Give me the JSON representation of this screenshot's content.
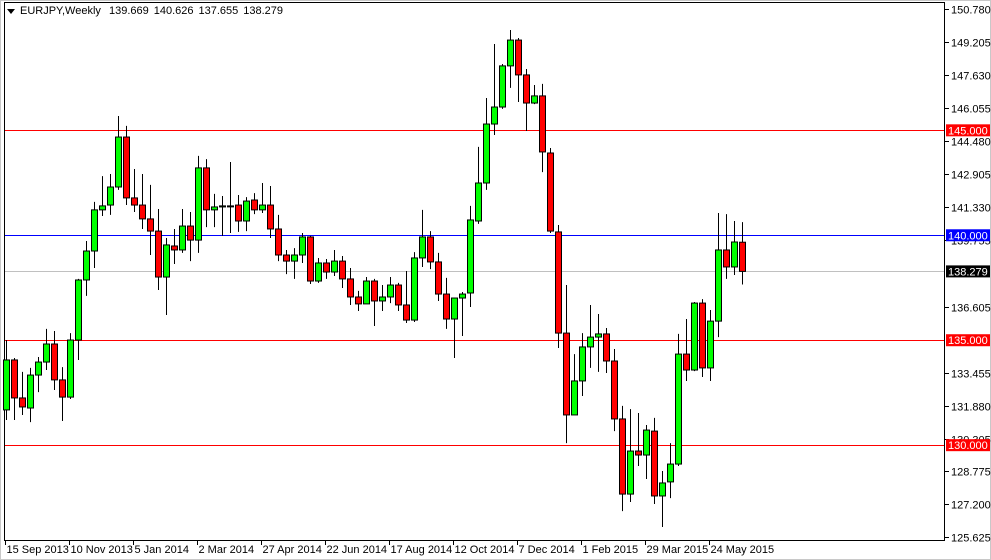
{
  "header": {
    "symbol_timeframe": "EURJPY,Weekly",
    "open": "139.669",
    "high": "140.626",
    "low": "137.655",
    "close": "138.279"
  },
  "colors": {
    "bull": "#00ff00",
    "bear": "#ff0000",
    "level_red": "#ff0000",
    "level_blue": "#0000ff",
    "current": "#c0c0c0"
  },
  "chart_data": {
    "type": "candlestick",
    "title": "EURJPY,Weekly",
    "ylim": [
      125.625,
      150.78
    ],
    "y_ticks": [
      "150.780",
      "149.205",
      "147.630",
      "146.055",
      "144.480",
      "142.905",
      "141.330",
      "139.755",
      "136.605",
      "133.455",
      "131.880",
      "130.305",
      "128.775",
      "127.200",
      "125.625"
    ],
    "x_labels": [
      "15 Sep 2013",
      "10 Nov 2013",
      "5 Jan 2014",
      "2 Mar 2014",
      "27 Apr 2014",
      "22 Jun 2014",
      "17 Aug 2014",
      "12 Oct 2014",
      "7 Dec 2014",
      "1 Feb 2015",
      "29 Mar 2015",
      "24 May 2015"
    ],
    "x_label_every": 8,
    "levels": [
      {
        "price": 145.0,
        "label": "145.000",
        "color": "red"
      },
      {
        "price": 140.0,
        "label": "140.000",
        "color": "blue"
      },
      {
        "price": 135.0,
        "label": "135.000",
        "color": "red"
      },
      {
        "price": 130.0,
        "label": "130.000",
        "color": "red"
      }
    ],
    "current_price": {
      "price": 138.279,
      "label": "138.279"
    },
    "ohlc": [
      [
        131.68,
        135.01,
        131.2,
        134.06
      ],
      [
        134.06,
        134.15,
        131.2,
        132.25
      ],
      [
        132.25,
        133.49,
        131.44,
        131.82
      ],
      [
        131.77,
        133.68,
        131.1,
        133.34
      ],
      [
        133.34,
        134.2,
        132.53,
        133.96
      ],
      [
        133.96,
        135.54,
        133.58,
        134.82
      ],
      [
        134.82,
        135.44,
        132.63,
        133.11
      ],
      [
        133.11,
        133.72,
        131.15,
        132.29
      ],
      [
        132.29,
        135.34,
        132.2,
        135.01
      ],
      [
        135.01,
        137.92,
        134.06,
        137.87
      ],
      [
        137.87,
        139.73,
        137.11,
        139.25
      ],
      [
        139.25,
        141.59,
        138.44,
        141.21
      ],
      [
        141.21,
        142.82,
        140.92,
        141.4
      ],
      [
        141.44,
        142.92,
        140.97,
        142.3
      ],
      [
        142.3,
        145.68,
        142.16,
        144.68
      ],
      [
        144.68,
        145.21,
        141.44,
        141.78
      ],
      [
        141.78,
        143.16,
        141.11,
        141.44
      ],
      [
        141.44,
        142.92,
        140.3,
        140.78
      ],
      [
        140.78,
        142.4,
        139.06,
        140.2
      ],
      [
        140.2,
        141.25,
        137.39,
        138.01
      ],
      [
        138.01,
        139.87,
        136.2,
        139.54
      ],
      [
        139.49,
        140.3,
        138.63,
        139.3
      ],
      [
        139.3,
        141.25,
        139.16,
        140.44
      ],
      [
        140.44,
        141.11,
        138.77,
        139.77
      ],
      [
        139.77,
        143.78,
        139.16,
        143.21
      ],
      [
        143.21,
        143.63,
        140.39,
        141.21
      ],
      [
        141.21,
        141.97,
        140.39,
        141.35
      ],
      [
        141.35,
        141.87,
        139.97,
        141.4
      ],
      [
        141.4,
        143.49,
        140.11,
        141.38
      ],
      [
        141.44,
        141.92,
        140.16,
        140.68
      ],
      [
        140.68,
        141.82,
        140.2,
        141.63
      ],
      [
        141.68,
        142.01,
        141.01,
        141.21
      ],
      [
        141.21,
        142.49,
        141.06,
        141.44
      ],
      [
        141.44,
        142.35,
        139.87,
        140.3
      ],
      [
        140.3,
        140.97,
        138.77,
        139.06
      ],
      [
        139.06,
        139.3,
        138.15,
        138.77
      ],
      [
        138.77,
        139.39,
        137.92,
        139.06
      ],
      [
        139.06,
        140.11,
        138.68,
        139.92
      ],
      [
        139.92,
        139.97,
        137.68,
        137.82
      ],
      [
        137.82,
        138.92,
        137.73,
        138.68
      ],
      [
        138.68,
        138.87,
        137.92,
        138.25
      ],
      [
        138.25,
        139.3,
        138.06,
        138.77
      ],
      [
        138.77,
        139.01,
        137.49,
        137.92
      ],
      [
        137.92,
        138.44,
        136.68,
        137.06
      ],
      [
        137.06,
        137.35,
        136.39,
        136.73
      ],
      [
        136.73,
        138.01,
        136.73,
        137.82
      ],
      [
        137.82,
        137.92,
        135.68,
        136.87
      ],
      [
        136.87,
        137.63,
        136.39,
        137.06
      ],
      [
        137.06,
        138.01,
        136.77,
        137.63
      ],
      [
        137.63,
        137.73,
        136.39,
        136.68
      ],
      [
        136.68,
        138.3,
        135.82,
        135.96
      ],
      [
        135.96,
        139.2,
        135.87,
        138.92
      ],
      [
        138.92,
        141.21,
        138.49,
        139.92
      ],
      [
        139.92,
        140.2,
        138.39,
        138.73
      ],
      [
        138.73,
        139.16,
        136.87,
        137.2
      ],
      [
        137.2,
        137.97,
        135.54,
        136.01
      ],
      [
        136.01,
        137.01,
        134.15,
        137.01
      ],
      [
        137.01,
        137.3,
        135.2,
        137.2
      ],
      [
        137.25,
        141.4,
        136.58,
        140.73
      ],
      [
        140.68,
        144.21,
        140.54,
        142.49
      ],
      [
        142.49,
        146.54,
        142.16,
        145.3
      ],
      [
        145.3,
        149.11,
        144.78,
        146.11
      ],
      [
        146.11,
        148.16,
        146.02,
        148.07
      ],
      [
        148.07,
        149.78,
        147.02,
        149.3
      ],
      [
        149.3,
        149.4,
        146.35,
        147.64
      ],
      [
        147.64,
        147.92,
        144.97,
        146.3
      ],
      [
        146.3,
        147.16,
        146.25,
        146.64
      ],
      [
        146.64,
        147.21,
        143.01,
        143.97
      ],
      [
        143.92,
        144.16,
        140.11,
        140.2
      ],
      [
        140.16,
        140.49,
        134.63,
        135.34
      ],
      [
        135.34,
        137.63,
        130.1,
        131.44
      ],
      [
        131.44,
        134.34,
        131.44,
        133.06
      ],
      [
        133.06,
        135.34,
        132.34,
        134.68
      ],
      [
        134.68,
        136.68,
        133.68,
        135.15
      ],
      [
        135.15,
        136.25,
        133.49,
        135.3
      ],
      [
        135.3,
        135.58,
        133.44,
        134.01
      ],
      [
        134.01,
        134.58,
        130.67,
        131.25
      ],
      [
        131.25,
        131.87,
        126.86,
        127.67
      ],
      [
        127.67,
        131.72,
        127.29,
        129.72
      ],
      [
        129.72,
        131.53,
        129.01,
        129.53
      ],
      [
        129.53,
        130.96,
        128.39,
        130.72
      ],
      [
        130.67,
        131.3,
        127.2,
        127.58
      ],
      [
        127.58,
        128.77,
        126.1,
        128.2
      ],
      [
        128.25,
        130.1,
        127.48,
        129.1
      ],
      [
        129.1,
        135.3,
        129.01,
        134.34
      ],
      [
        134.34,
        136.01,
        133.06,
        133.58
      ],
      [
        133.58,
        136.82,
        133.53,
        136.77
      ],
      [
        136.77,
        136.96,
        133.25,
        133.68
      ],
      [
        133.68,
        136.44,
        133.06,
        135.91
      ],
      [
        135.91,
        141.06,
        135.15,
        139.3
      ],
      [
        139.3,
        141.01,
        137.92,
        138.49
      ],
      [
        138.49,
        140.68,
        138.11,
        139.68
      ],
      [
        139.669,
        140.626,
        137.655,
        138.279
      ]
    ]
  }
}
